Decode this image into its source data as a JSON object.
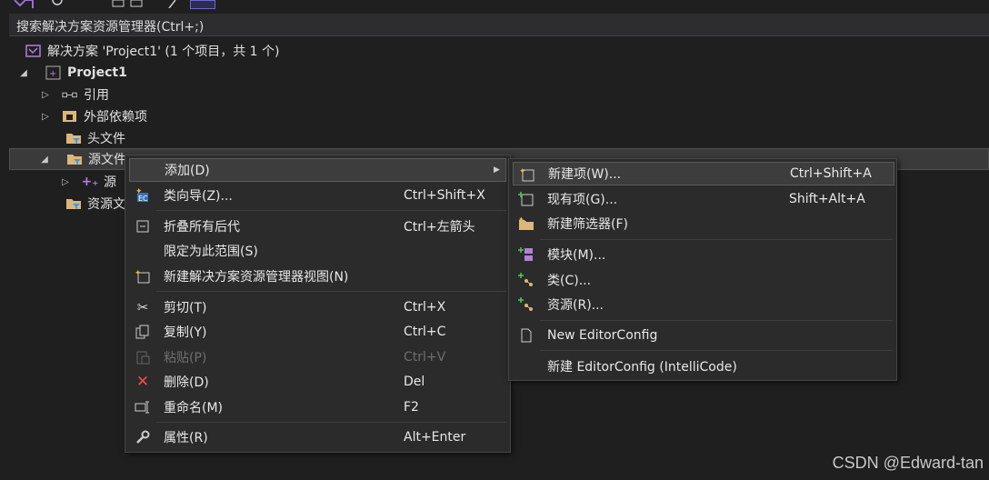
{
  "search": {
    "placeholder": "搜索解决方案资源管理器(Ctrl+;)"
  },
  "tree": {
    "solution": "解决方案 'Project1' (1 个项目，共 1 个)",
    "project": "Project1",
    "references": "引用",
    "external_deps": "外部依赖项",
    "header_files": "头文件",
    "source_files": "源文件",
    "source_child": "源",
    "resource_files": "资源文"
  },
  "context_menu": {
    "add": "添加(D)",
    "class_wizard": "类向导(Z)...",
    "class_wizard_sc": "Ctrl+Shift+X",
    "collapse": "折叠所有后代",
    "collapse_sc": "Ctrl+左箭头",
    "scope": "限定为此范围(S)",
    "new_view": "新建解决方案资源管理器视图(N)",
    "cut": "剪切(T)",
    "cut_sc": "Ctrl+X",
    "copy": "复制(Y)",
    "copy_sc": "Ctrl+C",
    "paste": "粘贴(P)",
    "paste_sc": "Ctrl+V",
    "delete": "删除(D)",
    "delete_sc": "Del",
    "rename": "重命名(M)",
    "rename_sc": "F2",
    "properties": "属性(R)",
    "properties_sc": "Alt+Enter"
  },
  "submenu": {
    "new_item": "新建项(W)...",
    "new_item_sc": "Ctrl+Shift+A",
    "existing_item": "现有项(G)...",
    "existing_item_sc": "Shift+Alt+A",
    "new_filter": "新建筛选器(F)",
    "module": "模块(M)...",
    "class": "类(C)...",
    "resource": "资源(R)...",
    "editorconfig": "New EditorConfig",
    "editorconfig_ic": "新建 EditorConfig (IntelliCode)"
  },
  "watermark": "CSDN @Edward-tan",
  "colors": {
    "background": "#1f1f1f",
    "menu": "#2b2b2b",
    "highlight": "#3d3d3d",
    "folder": "#dcb67a",
    "accent_purple": "#b180d7",
    "delete_red": "#f14c4c"
  }
}
